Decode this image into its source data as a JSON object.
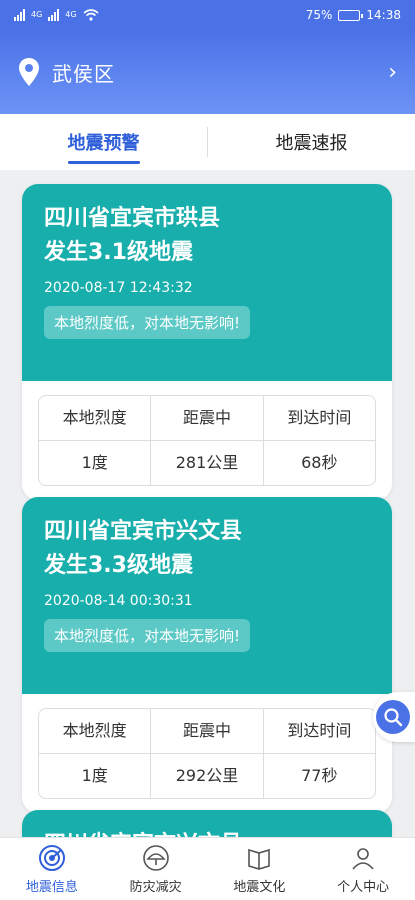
{
  "status_bar": {
    "battery": "75%",
    "time": "14:38",
    "net1": "4G",
    "net2": "4G",
    "battery_level": 0.75
  },
  "header": {
    "district": "武侯区"
  },
  "tabs": [
    {
      "label": "地震预警",
      "active": true
    },
    {
      "label": "地震速报",
      "active": false
    }
  ],
  "table_headers": {
    "intensity": "本地烈度",
    "distance": "距震中",
    "arrival": "到达时间"
  },
  "cards": [
    {
      "title_line1": "四川省宜宾市珙县",
      "title_line2": "发生3.1级地震",
      "time": "2020-08-17 12:43:32",
      "hint": "本地烈度低，对本地无影响!",
      "intensity": "1度",
      "distance": "281公里",
      "arrival": "68秒"
    },
    {
      "title_line1": "四川省宜宾市兴文县",
      "title_line2": "发生3.3级地震",
      "time": "2020-08-14 00:30:31",
      "hint": "本地烈度低，对本地无影响!",
      "intensity": "1度",
      "distance": "292公里",
      "arrival": "77秒"
    },
    {
      "title_line1": "四川省宜宾市兴文县"
    }
  ],
  "bottom_nav": [
    {
      "label": "地震信息",
      "icon": "radar-icon",
      "active": true
    },
    {
      "label": "防灾减灾",
      "icon": "umbrella-icon",
      "active": false
    },
    {
      "label": "地震文化",
      "icon": "book-icon",
      "active": false
    },
    {
      "label": "个人中心",
      "icon": "user-icon",
      "active": false
    }
  ],
  "colors": {
    "header": "#4a72e6",
    "card": "#17aeab",
    "accent": "#2f5fd9"
  }
}
